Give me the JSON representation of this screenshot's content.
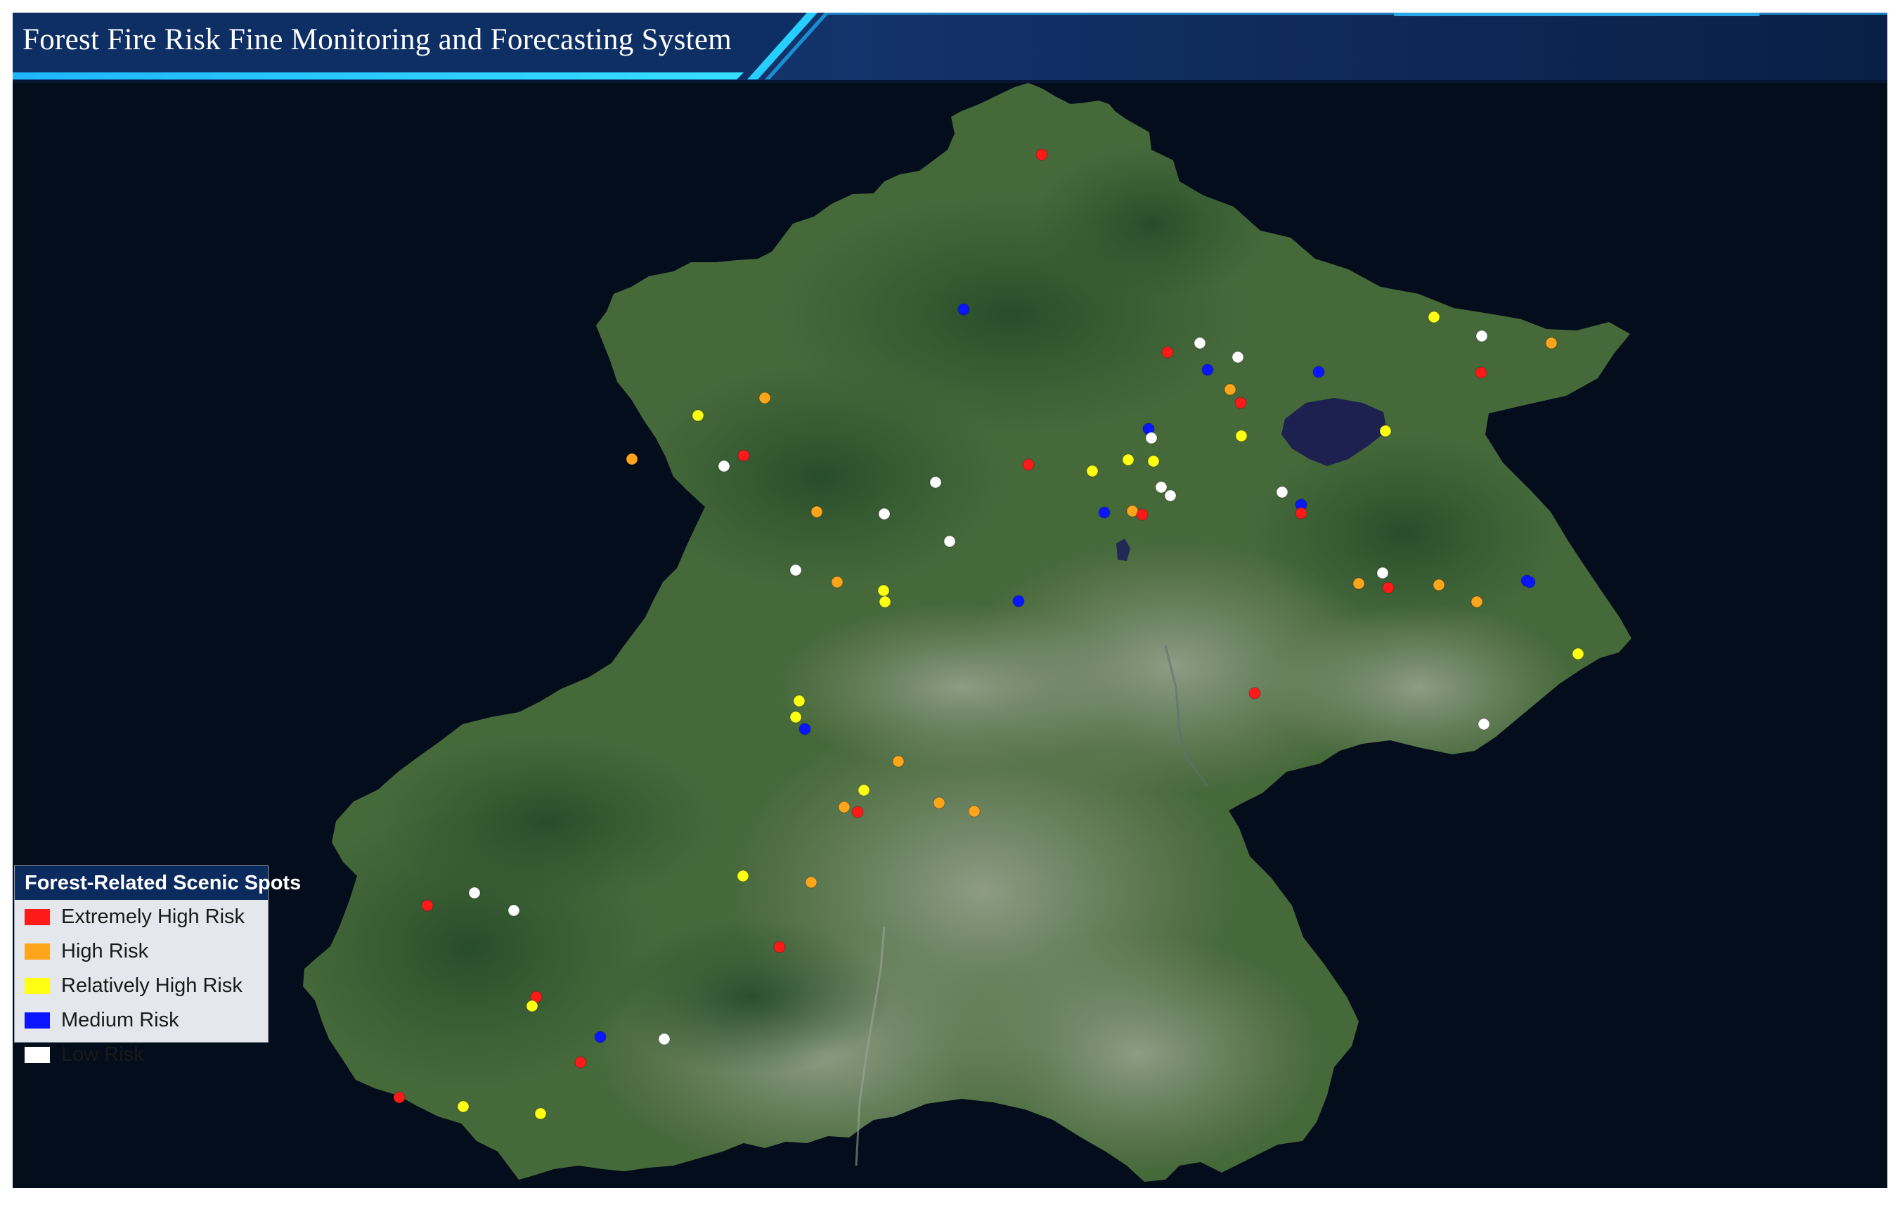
{
  "header": {
    "title": "Forest Fire Risk Fine Monitoring and Forecasting System"
  },
  "legend": {
    "title": "Forest-Related Scenic Spots",
    "items": [
      {
        "key": "extreme",
        "label": "Extremely High Risk",
        "color": "#ff1a1a"
      },
      {
        "key": "high",
        "label": "High Risk",
        "color": "#ffa51c"
      },
      {
        "key": "relhigh",
        "label": "Relatively High Risk",
        "color": "#ffff14"
      },
      {
        "key": "medium",
        "label": "Medium Risk",
        "color": "#0a16ff"
      },
      {
        "key": "low",
        "label": "Low Risk",
        "color": "#ffffff"
      }
    ]
  },
  "colors": {
    "background": "#030d1b",
    "header_band": "#0b2147",
    "header_accent": "#19c8ff",
    "land": "#4a6f3c",
    "reservoir": "#1c2150"
  },
  "map": {
    "region_label": "",
    "spot_risk_levels": [
      "extreme",
      "medium",
      "relhigh",
      "low",
      "high",
      "low",
      "extreme",
      "low",
      "medium",
      "extreme",
      "high",
      "medium",
      "extreme",
      "relhigh",
      "high",
      "relhigh",
      "high",
      "low",
      "extreme",
      "medium",
      "low",
      "relhigh",
      "extreme",
      "relhigh",
      "relhigh",
      "relhigh",
      "low",
      "low",
      "low",
      "low",
      "high",
      "medium",
      "extreme",
      "medium",
      "extreme",
      "high",
      "low",
      "low",
      "medium",
      "low",
      "high",
      "relhigh",
      "relhigh",
      "medium",
      "low",
      "high",
      "extreme",
      "high",
      "high",
      "relhigh",
      "extreme",
      "low",
      "relhigh",
      "relhigh",
      "medium",
      "high",
      "relhigh",
      "extreme",
      "high",
      "high",
      "high",
      "relhigh",
      "high",
      "extreme",
      "extreme",
      "low",
      "low",
      "extreme",
      "relhigh",
      "medium",
      "low",
      "extreme",
      "extreme",
      "relhigh",
      "relhigh",
      "medium"
    ]
  }
}
